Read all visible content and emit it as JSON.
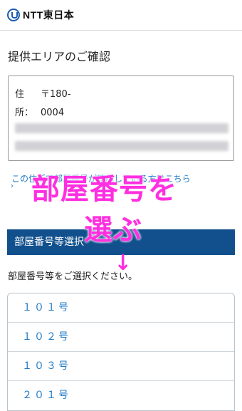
{
  "header": {
    "logo_text": "NTT東日本"
  },
  "page": {
    "title": "提供エリアのご確認"
  },
  "address": {
    "label_1": "住",
    "label_2": "所：",
    "postal": "〒180-",
    "postal_2": "0004"
  },
  "link": {
    "text": "この住所で部屋番号が確認している方はこちら"
  },
  "overlay": {
    "line1": "部屋番号を",
    "line2": "選ぶ",
    "arrow": "↓"
  },
  "section": {
    "title": "部屋番号等選択"
  },
  "instruction": "部屋番号等をご選択ください。",
  "rooms": [
    {
      "label": "１０１号"
    },
    {
      "label": "１０２号"
    },
    {
      "label": "１０３号"
    },
    {
      "label": "２０１号"
    }
  ]
}
